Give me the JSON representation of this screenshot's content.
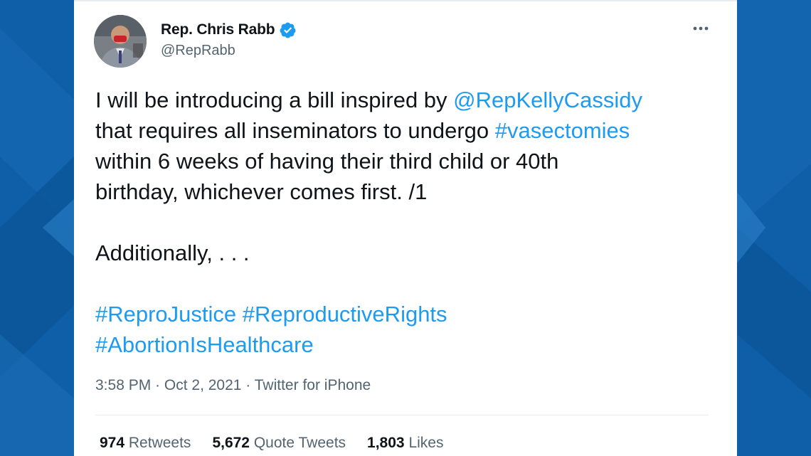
{
  "colors": {
    "background_blue": "#0f5fa8",
    "card": "#ffffff",
    "text": "#0f1419",
    "muted": "#536471",
    "link": "#1d9bf0",
    "verified": "#1d9bf0"
  },
  "tweet": {
    "author": {
      "display_name": "Rep. Chris Rabb",
      "handle": "@RepRabb",
      "verified_icon": "verified-badge-icon",
      "avatar_icon": "profile-photo"
    },
    "more_icon": "ellipsis-icon",
    "body": {
      "line1_text": "I will be introducing a bill inspired by ",
      "mention": "@RepKellyCassidy",
      "line2_text": "that requires all inseminators to undergo ",
      "hashtag_vasectomies": "#vasectomies",
      "line3_text": "within 6 weeks of having their third child or 40th",
      "line4_text": "birthday, whichever comes first. /1",
      "additionally": "Additionally, . . .",
      "hashtag_reprojustice": "#ReproJustice",
      "hashtag_reproductiverights": "#ReproductiveRights",
      "hashtag_abortion": "#AbortionIsHealthcare"
    },
    "meta": {
      "time": "3:58 PM",
      "separator": " · ",
      "date": "Oct 2, 2021",
      "source": "Twitter for iPhone"
    },
    "stats": {
      "retweets_count": "974",
      "retweets_label": "Retweets",
      "quote_count": "5,672",
      "quote_label": "Quote Tweets",
      "likes_count": "1,803",
      "likes_label": "Likes"
    }
  }
}
